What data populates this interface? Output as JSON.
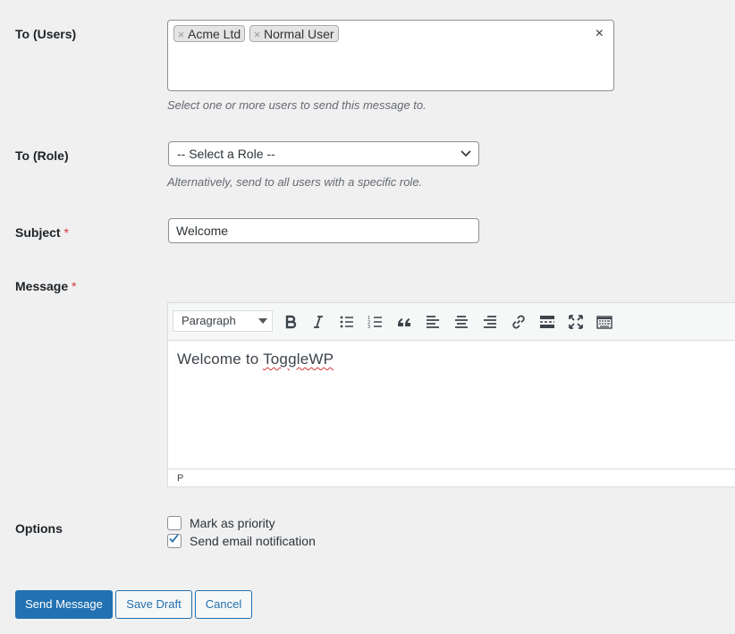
{
  "users": {
    "label": "To (Users)",
    "tags": [
      {
        "remove": "×",
        "text": "Acme Ltd"
      },
      {
        "remove": "×",
        "text": "Normal User"
      }
    ],
    "clear": "×",
    "description": "Select one or more users to send this message to."
  },
  "role": {
    "label": "To (Role)",
    "selected": "-- Select a Role --",
    "description": "Alternatively, send to all users with a specific role."
  },
  "subject": {
    "label": "Subject",
    "required_mark": "*",
    "value": "Welcome"
  },
  "message": {
    "label": "Message",
    "required_mark": "*",
    "format": "Paragraph",
    "content_prefix": "Welcome to ",
    "content_misspelled": "ToggleWP",
    "status_path": "P",
    "toolbar_icons": [
      "bold-icon",
      "italic-icon",
      "bulleted-list-icon",
      "numbered-list-icon",
      "blockquote-icon",
      "align-left-icon",
      "align-center-icon",
      "align-right-icon",
      "link-icon",
      "read-more-icon",
      "fullscreen-icon",
      "toolbar-toggle-icon"
    ]
  },
  "options": {
    "label": "Options",
    "priority": {
      "label": "Mark as priority",
      "checked": false
    },
    "email": {
      "label": "Send email notification",
      "checked": true
    }
  },
  "actions": {
    "send": "Send Message",
    "draft": "Save Draft",
    "cancel": "Cancel"
  },
  "colors": {
    "primary": "#2271b1",
    "required": "#d63638",
    "background": "#f0f0f1"
  }
}
